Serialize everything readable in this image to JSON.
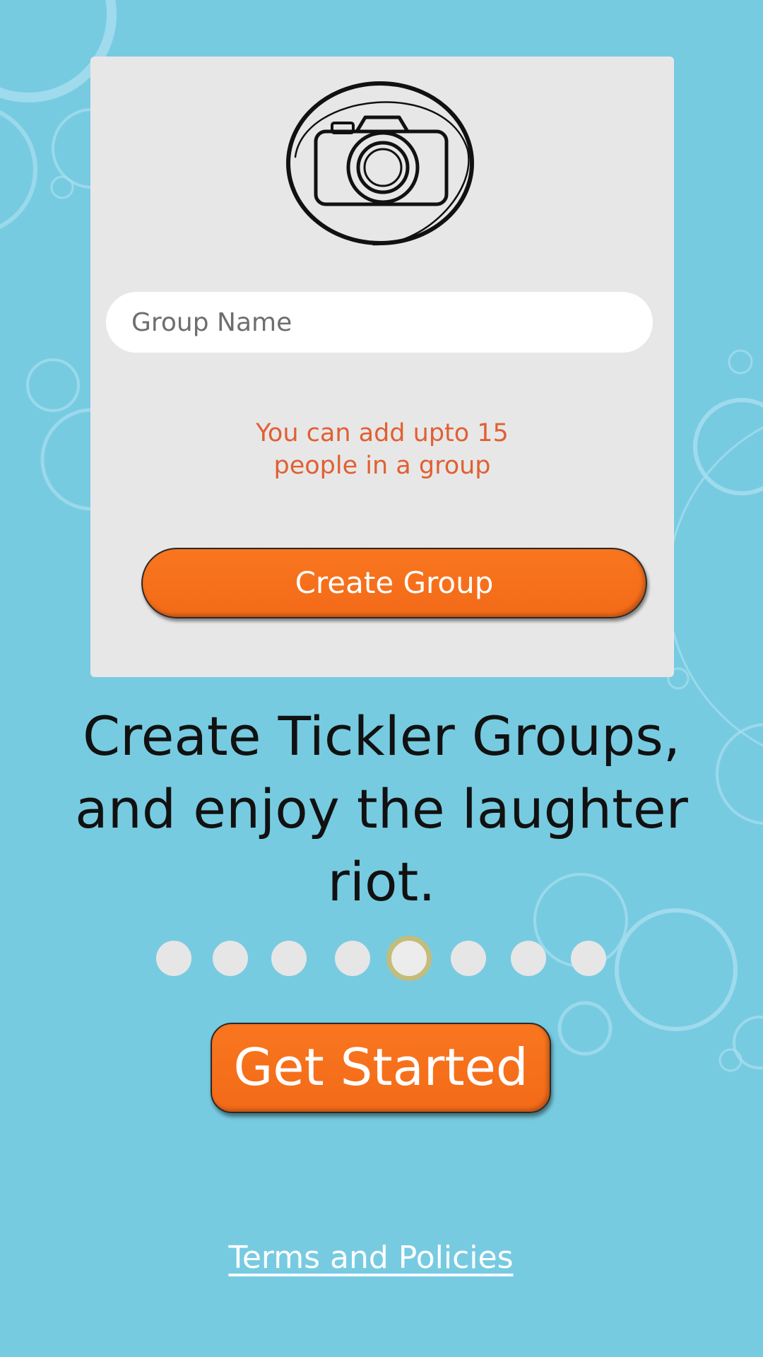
{
  "group_form": {
    "name_placeholder": "Group Name",
    "limit_note_line1": "You can add upto 15",
    "limit_note_line2": "people in a group",
    "create_button_label": "Create Group"
  },
  "onboarding": {
    "headline_line1": "Create Tickler Groups,",
    "headline_line2": "and enjoy the laughter",
    "headline_line3": "riot.",
    "page_count": 8,
    "active_page": 5,
    "get_started_label": "Get Started",
    "terms_label": "Terms and Policies"
  },
  "icons": {
    "camera": "camera-icon"
  },
  "colors": {
    "background": "#77cbe1",
    "card": "#e8e7e8",
    "accent_orange": "#f36a18",
    "note_text": "#e06032",
    "active_dot_ring": "#c3bc7a"
  }
}
